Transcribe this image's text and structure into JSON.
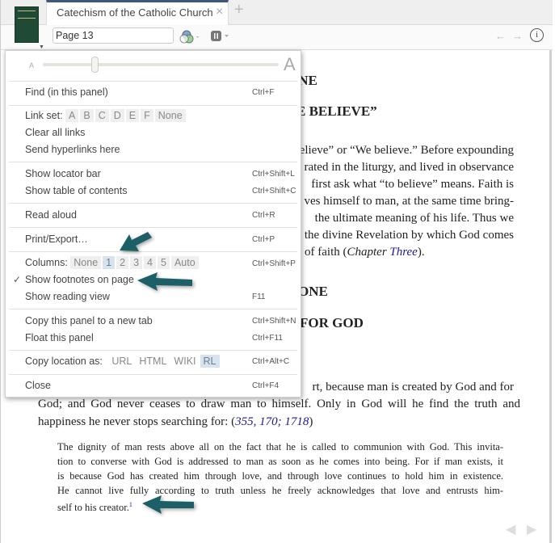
{
  "tab": {
    "title": "Catechism of the Catholic Church",
    "close": "×",
    "new_tab": "+"
  },
  "toolbar": {
    "page_value": "Page 13"
  },
  "menu": {
    "font_small": "A",
    "font_large": "A",
    "font_scale_level": 0.22,
    "find": {
      "label": "Find (in this panel)",
      "shortcut": "Ctrl+F"
    },
    "link_set": {
      "label": "Link set:",
      "options": [
        "A",
        "B",
        "C",
        "D",
        "E",
        "F",
        "None"
      ]
    },
    "clear_links": "Clear all links",
    "send_hyperlinks": "Send hyperlinks here",
    "locator": {
      "label": "Show locator bar",
      "shortcut": "Ctrl+Shift+L"
    },
    "toc": {
      "label": "Show table of contents",
      "shortcut": "Ctrl+Shift+C"
    },
    "read_aloud": {
      "label": "Read aloud",
      "shortcut": "Ctrl+R"
    },
    "print": {
      "label": "Print/Export…",
      "shortcut": "Ctrl+P"
    },
    "columns": {
      "label": "Columns:",
      "options": [
        "None",
        "1",
        "2",
        "3",
        "4",
        "5",
        "Auto"
      ],
      "selected": "1",
      "shortcut": "Ctrl+Shift+P"
    },
    "footnotes": {
      "label": "Show footnotes on page",
      "check": "✓"
    },
    "reading_view": {
      "label": "Show reading view",
      "shortcut": "F11"
    },
    "copy_panel": {
      "label": "Copy this panel to a new tab",
      "shortcut": "Ctrl+Shift+N"
    },
    "float_panel": {
      "label": "Float this panel",
      "shortcut": "Ctrl+F11"
    },
    "copy_location": {
      "label": "Copy location as:",
      "options": [
        "URL",
        "HTML",
        "WIKI",
        "RL"
      ],
      "selected": "RL",
      "shortcut": "Ctrl+Alt+C"
    },
    "close": {
      "label": "Close",
      "shortcut": "Ctrl+F4"
    }
  },
  "content": {
    "heading1": "ONE",
    "heading2": "E BELIEVE”",
    "para1": [
      "elieve” or “We believe.” Before expounding",
      "rated in the liturgy, and lived in observance",
      "first ask what “to believe” means. Faith is",
      "ves himself to man, at the same time bring-",
      "the ultimate meaning of his life. Thus we",
      "the divine Revelation by which God comes",
      "of faith ("
    ],
    "para1_italic": "Chapter ",
    "para1_link": "Three",
    "para1_end": ").",
    "heading3": "ONE",
    "heading4": "FOR GOD",
    "para2_line1": "rt, because man is created by God and for",
    "para2_line2": "God; and God never ceases to draw man to himself. Only in God will he find the truth and",
    "para2_line3": "happiness he never stops searching for: (",
    "para2_refs": "355, 170; 1718",
    "para2_end": ")",
    "quote": [
      "The dignity of man rests above all on the fact that he is called to communion with God. This invita-",
      "tion to converse with God is addressed to man as soon as he comes into being. For if man exists, it",
      "is because God has created him through love, and through love continues to hold him in existence.",
      "He cannot live fully according to truth unless he freely acknowledges that love and entrusts him-",
      "self to his creator."
    ],
    "footnote_mark": "1"
  },
  "colors": {
    "accent": "#3d5878",
    "arrow": "#1d5f66",
    "link": "#1a1a8c"
  }
}
